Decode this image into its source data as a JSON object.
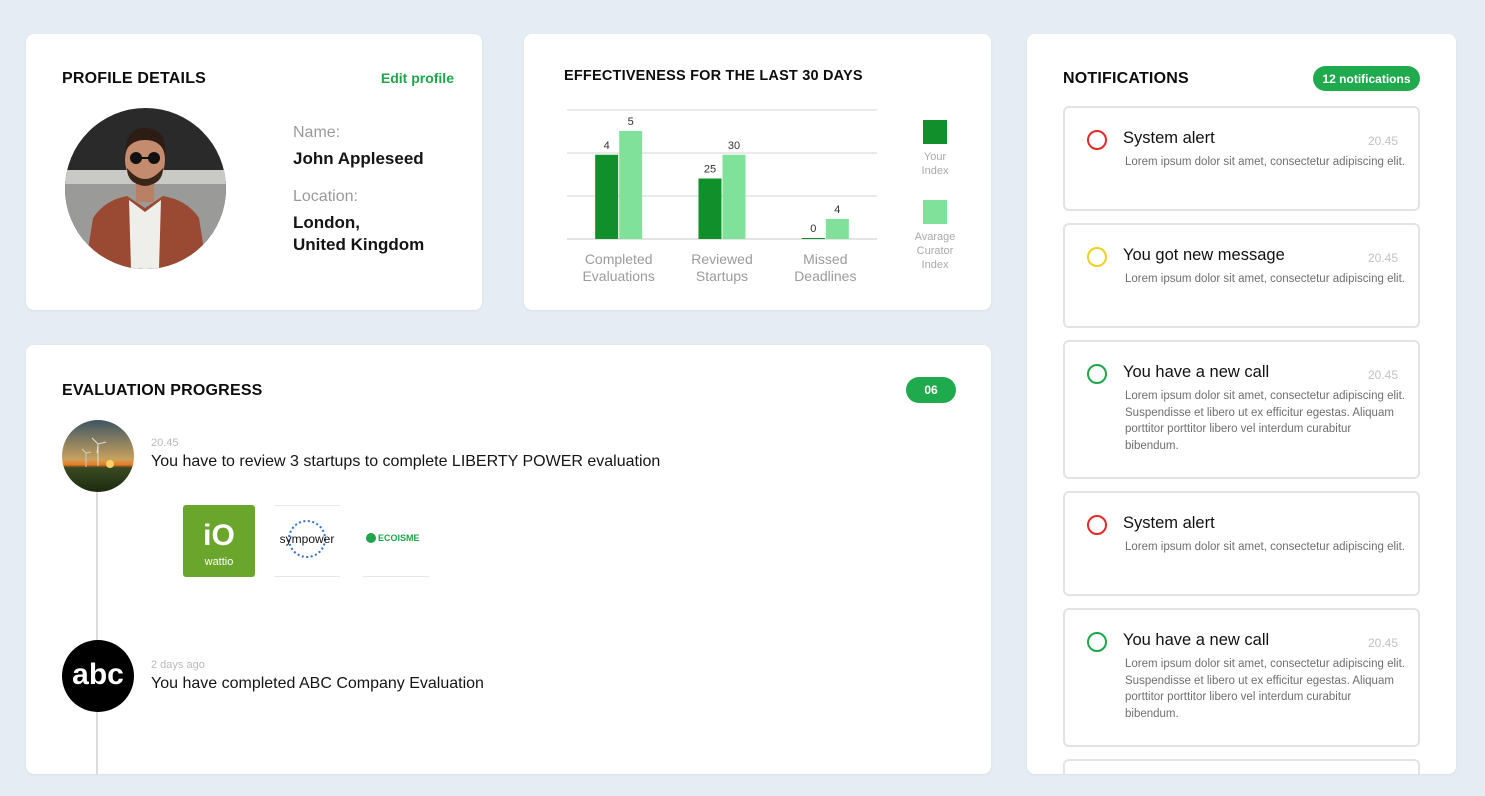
{
  "profile": {
    "title": "PROFILE DETAILS",
    "edit_label": "Edit profile",
    "name_label": "Name:",
    "name_value": "John Appleseed",
    "location_label": "Location:",
    "location_line1": "London,",
    "location_line2": "United Kingdom"
  },
  "effectiveness": {
    "title": "EFFECTIVENESS FOR THE LAST 30 DAYS"
  },
  "chart_data": {
    "type": "bar",
    "categories": [
      [
        "Completed",
        "Evaluations"
      ],
      [
        "Reviewed",
        "Startups"
      ],
      [
        "Missed",
        "Deadlines"
      ]
    ],
    "series": [
      {
        "name": "Your Index",
        "values": [
          4,
          25,
          0
        ],
        "color": "#118f2a"
      },
      {
        "name": "Avarage Curator Index",
        "values": [
          5,
          30,
          4
        ],
        "color": "#7fe19a"
      }
    ],
    "legend": [
      {
        "lines": [
          "Your",
          "Index"
        ],
        "color": "#118f2a"
      },
      {
        "lines": [
          "Avarage",
          "Curator",
          "Index"
        ],
        "color": "#7fe19a"
      }
    ],
    "grid": true,
    "legend_position": "right"
  },
  "progress": {
    "title": "EVALUATION PROGRESS",
    "count": "06",
    "items": [
      {
        "time": "20.45",
        "text": "You have to review 3 startups to complete LIBERTY POWER evaluation"
      },
      {
        "time": "2 days ago",
        "text": "You have completed ABC Company Evaluation"
      }
    ],
    "startups": [
      {
        "name": "wattio",
        "mark": "iO"
      },
      {
        "name": "sympower"
      },
      {
        "name": "ECOISME"
      }
    ],
    "abc_logo": "abc"
  },
  "notifications": {
    "title": "NOTIFICATIONS",
    "count_label": "12 notifications",
    "items": [
      {
        "title": "System alert",
        "time": "20.45",
        "status": "red",
        "body": "Lorem ipsum dolor sit amet, consectetur adipiscing elit."
      },
      {
        "title": "You got new message",
        "time": "20.45",
        "status": "yellow",
        "body": "Lorem ipsum dolor sit amet, consectetur adipiscing elit."
      },
      {
        "title": "You have a new call",
        "time": "20.45",
        "status": "green",
        "body": "Lorem ipsum dolor sit amet, consectetur adipiscing elit. Suspendisse et libero ut ex efficitur egestas. Aliquam porttitor porttitor libero vel interdum curabitur bibendum."
      },
      {
        "title": "System alert",
        "time": "",
        "status": "red",
        "body": "Lorem ipsum dolor sit amet, consectetur adipiscing elit."
      },
      {
        "title": "You have a new call",
        "time": "20.45",
        "status": "green",
        "body": "Lorem ipsum dolor sit amet, consectetur adipiscing elit. Suspendisse et libero ut ex efficitur egestas. Aliquam porttitor porttitor libero vel interdum curabitur bibendum."
      }
    ]
  },
  "colors": {
    "accent": "#1faa4e",
    "status_red": "#e62828",
    "status_yellow": "#f0d21e",
    "status_green": "#1fa54a"
  }
}
